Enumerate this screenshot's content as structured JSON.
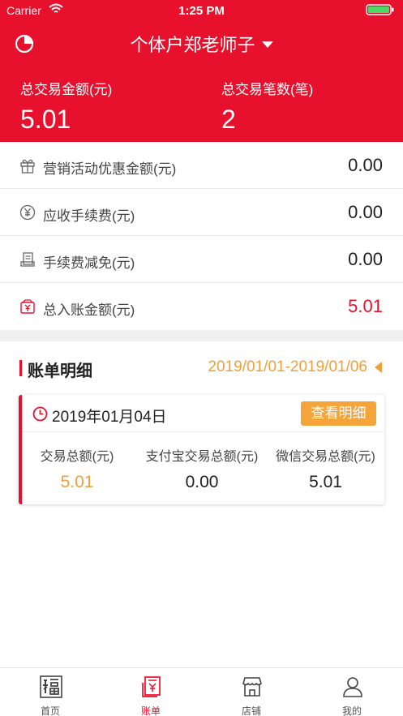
{
  "status_bar": {
    "carrier": "Carrier",
    "time": "1:25 PM"
  },
  "header": {
    "store_name": "个体户郑老师子",
    "total_amount_label": "总交易金额(元)",
    "total_amount": "5.01",
    "total_count_label": "总交易笔数(笔)",
    "total_count": "2"
  },
  "summary": [
    {
      "icon": "gift-icon",
      "label": "营销活动优惠金额(元)",
      "value": "0.00"
    },
    {
      "icon": "yen-circle-icon",
      "label": "应收手续费(元)",
      "value": "0.00"
    },
    {
      "icon": "receipt-icon",
      "label": "手续费减免(元)",
      "value": "0.00"
    },
    {
      "icon": "money-icon",
      "label": "总入账金额(元)",
      "value": "5.01"
    }
  ],
  "details": {
    "title": "账单明细",
    "date_range": "2019/01/01-2019/01/06",
    "card": {
      "date": "2019年01月04日",
      "button": "查看明细",
      "columns": [
        {
          "label": "交易总额(元)",
          "value": "5.01"
        },
        {
          "label": "支付宝交易总额(元)",
          "value": "0.00"
        },
        {
          "label": "微信交易总额(元)",
          "value": "5.01"
        }
      ]
    }
  },
  "tabs": [
    {
      "label": "首页",
      "icon": "fu-home-icon"
    },
    {
      "label": "账单",
      "icon": "bill-icon"
    },
    {
      "label": "店铺",
      "icon": "shop-icon"
    },
    {
      "label": "我的",
      "icon": "user-icon"
    }
  ],
  "colors": {
    "brand_red": "#e8112d",
    "accent_orange": "#f5a43a"
  }
}
